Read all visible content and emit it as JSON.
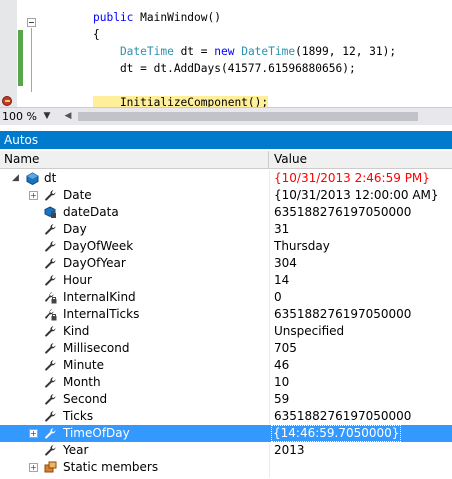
{
  "editor": {
    "lines": [
      {
        "parts": [
          {
            "t": "public ",
            "c": "kw"
          },
          {
            "t": "MainWindow()",
            "c": ""
          }
        ]
      },
      {
        "parts": [
          {
            "t": "{",
            "c": ""
          }
        ]
      },
      {
        "parts": [
          {
            "t": "    DateTime",
            "c": "ty"
          },
          {
            "t": " dt = ",
            "c": ""
          },
          {
            "t": "new ",
            "c": "kw"
          },
          {
            "t": "DateTime",
            "c": "ty"
          },
          {
            "t": "(1899, 12, 31);",
            "c": ""
          }
        ]
      },
      {
        "parts": [
          {
            "t": "    dt = dt.AddDays(41577.61596880656);",
            "c": ""
          }
        ]
      },
      {
        "parts": [
          {
            "t": "",
            "c": ""
          }
        ]
      },
      {
        "parts": [
          {
            "t": "    InitializeComponent();",
            "c": "hl"
          }
        ]
      }
    ]
  },
  "zoom": {
    "level": "100 %"
  },
  "autos": {
    "title": "Autos",
    "columns": {
      "name": "Name",
      "value": "Value"
    },
    "rows": [
      {
        "name": "dt",
        "value": "{10/31/2013 2:46:59 PM}",
        "expander": "expanded",
        "icon": "object-icon",
        "indent": 0,
        "changed": true
      },
      {
        "name": "Date",
        "value": "{10/31/2013 12:00:00 AM}",
        "expander": "collapsed",
        "icon": "wrench-icon",
        "indent": 1
      },
      {
        "name": "dateData",
        "value": "635188276197050000",
        "expander": "none",
        "icon": "private-field-icon",
        "indent": 1
      },
      {
        "name": "Day",
        "value": "31",
        "expander": "none",
        "icon": "wrench-icon",
        "indent": 1
      },
      {
        "name": "DayOfWeek",
        "value": "Thursday",
        "expander": "none",
        "icon": "wrench-icon",
        "indent": 1
      },
      {
        "name": "DayOfYear",
        "value": "304",
        "expander": "none",
        "icon": "wrench-icon",
        "indent": 1
      },
      {
        "name": "Hour",
        "value": "14",
        "expander": "none",
        "icon": "wrench-icon",
        "indent": 1
      },
      {
        "name": "InternalKind",
        "value": "0",
        "expander": "none",
        "icon": "private-property-icon",
        "indent": 1
      },
      {
        "name": "InternalTicks",
        "value": "635188276197050000",
        "expander": "none",
        "icon": "private-property-icon",
        "indent": 1
      },
      {
        "name": "Kind",
        "value": "Unspecified",
        "expander": "none",
        "icon": "wrench-icon",
        "indent": 1
      },
      {
        "name": "Millisecond",
        "value": "705",
        "expander": "none",
        "icon": "wrench-icon",
        "indent": 1
      },
      {
        "name": "Minute",
        "value": "46",
        "expander": "none",
        "icon": "wrench-icon",
        "indent": 1
      },
      {
        "name": "Month",
        "value": "10",
        "expander": "none",
        "icon": "wrench-icon",
        "indent": 1
      },
      {
        "name": "Second",
        "value": "59",
        "expander": "none",
        "icon": "wrench-icon",
        "indent": 1
      },
      {
        "name": "Ticks",
        "value": "635188276197050000",
        "expander": "none",
        "icon": "wrench-icon",
        "indent": 1
      },
      {
        "name": "TimeOfDay",
        "value": "{14:46:59.7050000}",
        "expander": "collapsed",
        "icon": "wrench-icon",
        "indent": 1,
        "selected": true
      },
      {
        "name": "Year",
        "value": "2013",
        "expander": "none",
        "icon": "wrench-icon",
        "indent": 1
      },
      {
        "name": "Static members",
        "value": "",
        "expander": "collapsed",
        "icon": "static-members-icon",
        "indent": 1
      }
    ]
  },
  "colors": {
    "accent": "#007acc",
    "selection": "#3399ff",
    "changed": "#ff0000",
    "keyword": "#0000ff",
    "type": "#2b91af"
  }
}
